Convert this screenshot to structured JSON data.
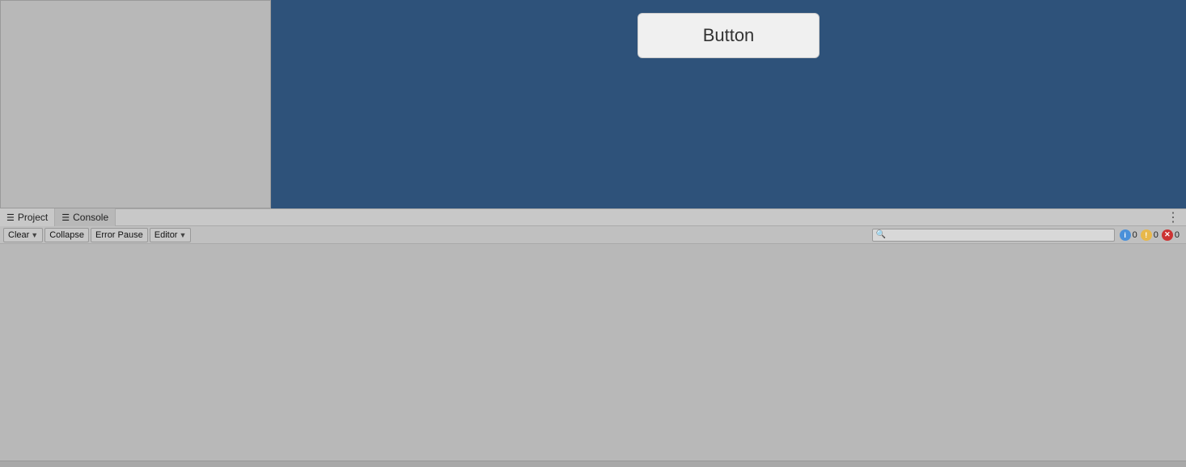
{
  "scene": {
    "button_label": "Button"
  },
  "tabs": {
    "project_label": "Project",
    "console_label": "Console",
    "project_icon": "☰",
    "console_icon": "☰"
  },
  "toolbar": {
    "clear_label": "Clear",
    "collapse_label": "Collapse",
    "error_pause_label": "Error Pause",
    "editor_label": "Editor",
    "search_placeholder": "",
    "badge_info_count": "0",
    "badge_warn_count": "0",
    "badge_error_count": "0"
  },
  "icons": {
    "search": "🔍",
    "more_vert": "⋮",
    "info": "i",
    "warn": "!",
    "error": "✕"
  }
}
